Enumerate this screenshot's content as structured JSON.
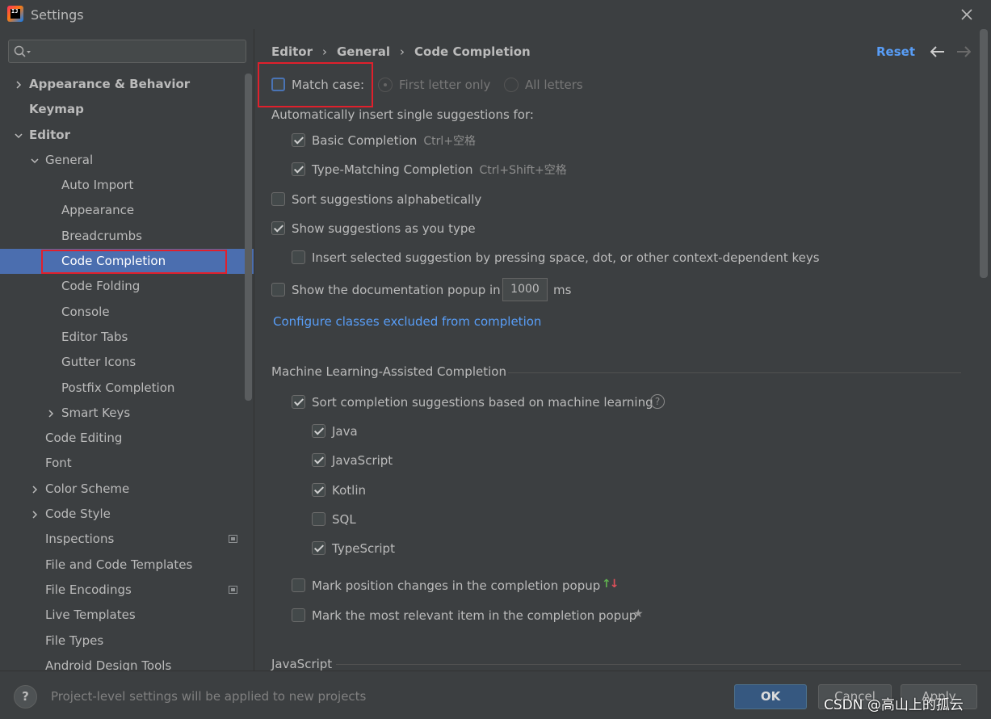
{
  "window": {
    "title": "Settings"
  },
  "search": {
    "placeholder": ""
  },
  "sidebar": {
    "items": [
      {
        "label": "Appearance & Behavior",
        "level": 0,
        "bold": true,
        "expandable": true,
        "expanded": false
      },
      {
        "label": "Keymap",
        "level": 0,
        "bold": true
      },
      {
        "label": "Editor",
        "level": 0,
        "bold": true,
        "expandable": true,
        "expanded": true
      },
      {
        "label": "General",
        "level": 1,
        "expandable": true,
        "expanded": true
      },
      {
        "label": "Auto Import",
        "level": 2
      },
      {
        "label": "Appearance",
        "level": 2
      },
      {
        "label": "Breadcrumbs",
        "level": 2
      },
      {
        "label": "Code Completion",
        "level": 2,
        "selected": true
      },
      {
        "label": "Code Folding",
        "level": 2
      },
      {
        "label": "Console",
        "level": 2
      },
      {
        "label": "Editor Tabs",
        "level": 2
      },
      {
        "label": "Gutter Icons",
        "level": 2
      },
      {
        "label": "Postfix Completion",
        "level": 2
      },
      {
        "label": "Smart Keys",
        "level": 2,
        "expandable": true,
        "expanded": false
      },
      {
        "label": "Code Editing",
        "level": 1
      },
      {
        "label": "Font",
        "level": 1
      },
      {
        "label": "Color Scheme",
        "level": 1,
        "expandable": true,
        "expanded": false
      },
      {
        "label": "Code Style",
        "level": 1,
        "expandable": true,
        "expanded": false
      },
      {
        "label": "Inspections",
        "level": 1,
        "project_icon": true
      },
      {
        "label": "File and Code Templates",
        "level": 1
      },
      {
        "label": "File Encodings",
        "level": 1,
        "project_icon": true
      },
      {
        "label": "Live Templates",
        "level": 1
      },
      {
        "label": "File Types",
        "level": 1
      },
      {
        "label": "Android Design Tools",
        "level": 1
      }
    ]
  },
  "breadcrumb": {
    "items": [
      "Editor",
      "General",
      "Code Completion"
    ]
  },
  "header": {
    "reset_label": "Reset"
  },
  "settings": {
    "match_case": {
      "label": "Match case:",
      "checked": false
    },
    "first_letter_only": {
      "label": "First letter only",
      "selected": true,
      "enabled": false
    },
    "all_letters": {
      "label": "All letters",
      "selected": false,
      "enabled": false
    },
    "auto_insert_heading": "Automatically insert single suggestions for:",
    "basic_completion": {
      "label": "Basic Completion",
      "shortcut": "Ctrl+空格",
      "checked": true
    },
    "type_matching": {
      "label": "Type-Matching Completion",
      "shortcut": "Ctrl+Shift+空格",
      "checked": true
    },
    "sort_alpha": {
      "label": "Sort suggestions alphabetically",
      "checked": false
    },
    "show_as_type": {
      "label": "Show suggestions as you type",
      "checked": true
    },
    "insert_selected": {
      "label": "Insert selected suggestion by pressing space, dot, or other context-dependent keys",
      "checked": false
    },
    "doc_popup": {
      "label": "Show the documentation popup in",
      "value": "1000",
      "unit": "ms",
      "checked": false
    },
    "configure_link": "Configure classes excluded from completion",
    "ml_section": "Machine Learning-Assisted Completion",
    "ml_sort": {
      "label": "Sort completion suggestions based on machine learning",
      "checked": true
    },
    "ml_languages": [
      {
        "label": "Java",
        "checked": true
      },
      {
        "label": "JavaScript",
        "checked": true
      },
      {
        "label": "Kotlin",
        "checked": true
      },
      {
        "label": "SQL",
        "checked": false
      },
      {
        "label": "TypeScript",
        "checked": true
      }
    ],
    "mark_position": {
      "label": "Mark position changes in the completion popup",
      "checked": false
    },
    "mark_relevant": {
      "label": "Mark the most relevant item in the completion popup",
      "checked": false
    },
    "js_section": "JavaScript"
  },
  "footer": {
    "help_label": "?",
    "info_text": "Project-level settings will be applied to new projects",
    "ok_label": "OK",
    "cancel_label": "Cancel",
    "apply_label": "Apply"
  },
  "watermark": "CSDN @高山上的孤云",
  "colors": {
    "accent": "#4b6eaf",
    "link": "#589df6",
    "highlight": "#e0202c",
    "background": "#3c3f41"
  }
}
